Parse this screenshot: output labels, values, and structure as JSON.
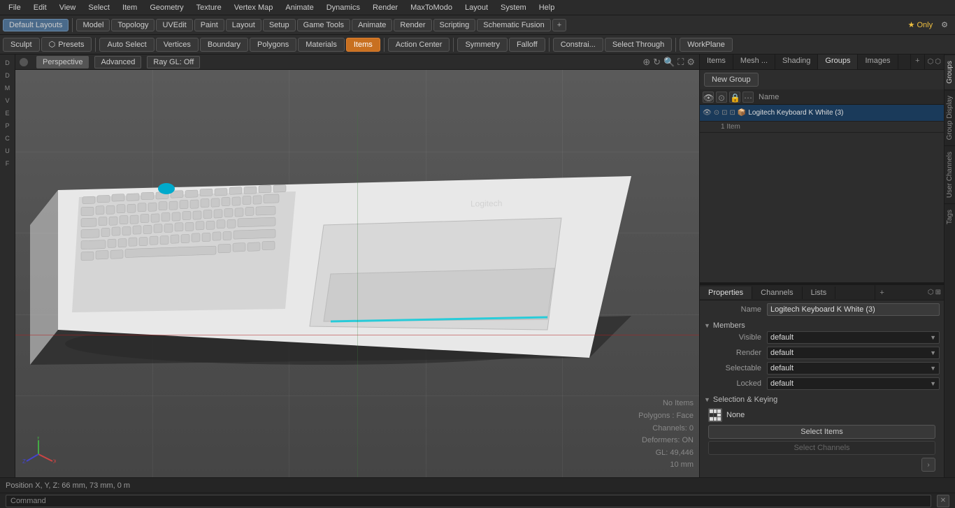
{
  "menubar": {
    "items": [
      "File",
      "Edit",
      "View",
      "Select",
      "Item",
      "Geometry",
      "Texture",
      "Vertex Map",
      "Animate",
      "Dynamics",
      "Render",
      "MaxToModo",
      "Layout",
      "System",
      "Help"
    ]
  },
  "toolbar1": {
    "layout_label": "Default Layouts",
    "tabs": [
      "Model",
      "Topology",
      "UVEdit",
      "Paint",
      "Layout",
      "Setup",
      "Game Tools",
      "Animate",
      "Render",
      "Scripting",
      "Schematic Fusion"
    ],
    "plus": "+",
    "star_label": "★ Only",
    "gear": "⚙"
  },
  "toolbar2": {
    "sculpt": "Sculpt",
    "presets": "Presets",
    "auto_select": "Auto Select",
    "vertices": "Vertices",
    "boundary": "Boundary",
    "polygons": "Polygons",
    "materials": "Materials",
    "items": "Items",
    "action_center": "Action Center",
    "symmetry": "Symmetry",
    "falloff": "Falloff",
    "constraints": "Constrai...",
    "select_through": "Select Through",
    "workplane": "WorkPlane"
  },
  "viewport": {
    "perspective": "Perspective",
    "advanced": "Advanced",
    "ray_gl": "Ray GL: Off"
  },
  "viewport_status": {
    "no_items": "No Items",
    "polygons": "Polygons : Face",
    "channels": "Channels: 0",
    "deformers": "Deformers: ON",
    "gl": "GL: 49,446",
    "size": "10 mm"
  },
  "right_panel": {
    "tabs": [
      "Items",
      "Mesh ...",
      "Shading",
      "Groups",
      "Images"
    ],
    "new_group": "New Group",
    "list_header": "Name",
    "item_name": "Logitech Keyboard K White (3)",
    "item_sub": "1 Item",
    "item_full_name": "Logitech Keyboard K White (3) ..."
  },
  "properties": {
    "tabs": [
      "Properties",
      "Channels",
      "Lists"
    ],
    "name_label": "Name",
    "name_value": "Logitech Keyboard K White (3)",
    "members_section": "Members",
    "visible_label": "Visible",
    "visible_value": "default",
    "render_label": "Render",
    "render_value": "default",
    "selectable_label": "Selectable",
    "selectable_value": "default",
    "locked_label": "Locked",
    "locked_value": "default",
    "sel_keying_section": "Selection & Keying",
    "none_label": "None",
    "select_items_btn": "Select Items",
    "select_channels_btn": "Select Channels"
  },
  "right_vtabs": {
    "tabs": [
      "Groups",
      "Group Display",
      "User Channels",
      "Tags"
    ]
  },
  "status_bar": {
    "position": "Position X, Y, Z:  66 mm, 73 mm, 0 m",
    "command_label": "Command",
    "command_placeholder": ""
  }
}
